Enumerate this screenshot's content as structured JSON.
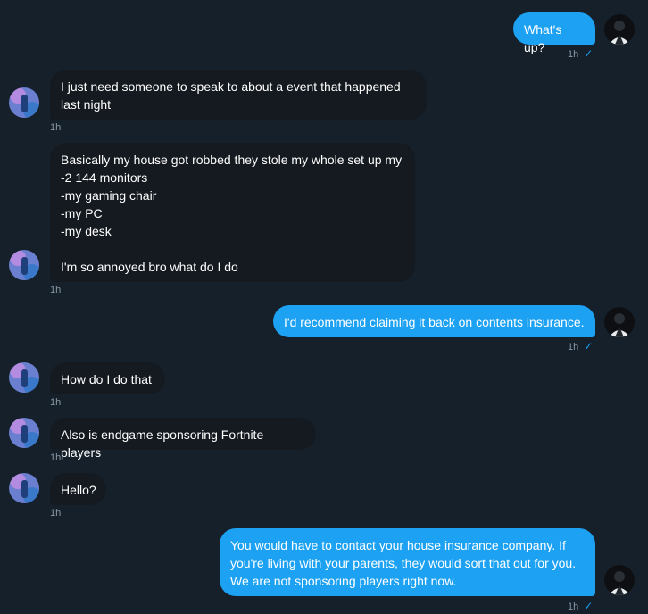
{
  "messages": [
    {
      "direction": "out",
      "text": "What's up?",
      "time": "1h"
    },
    {
      "direction": "in",
      "text": "I just need someone to speak to about a event that happened last night",
      "time": "1h"
    },
    {
      "direction": "in",
      "text": "Basically my house got robbed they stole my whole set up my\n-2 144 monitors\n-my gaming chair\n-my PC\n-my desk\n\nI'm so annoyed bro what do I do",
      "time": "1h"
    },
    {
      "direction": "out",
      "text": "I'd recommend claiming it back on contents insurance.",
      "time": "1h"
    },
    {
      "direction": "in",
      "text": "How do I do that",
      "time": "1h"
    },
    {
      "direction": "in",
      "text": "Also is endgame sponsoring Fortnite players",
      "time": "1h"
    },
    {
      "direction": "in",
      "text": "Hello?",
      "time": "1h"
    },
    {
      "direction": "out",
      "text": "You would have to contact your house insurance company. If you're living with your parents, they would sort that out for you. We are not sponsoring players right now.",
      "time": "1h"
    }
  ],
  "read_receipt_icon": "check-icon",
  "colors": {
    "background": "#15202b",
    "incoming_bubble": "#141a20",
    "outgoing_bubble": "#1da1f2",
    "timestamp": "#8899a6"
  }
}
